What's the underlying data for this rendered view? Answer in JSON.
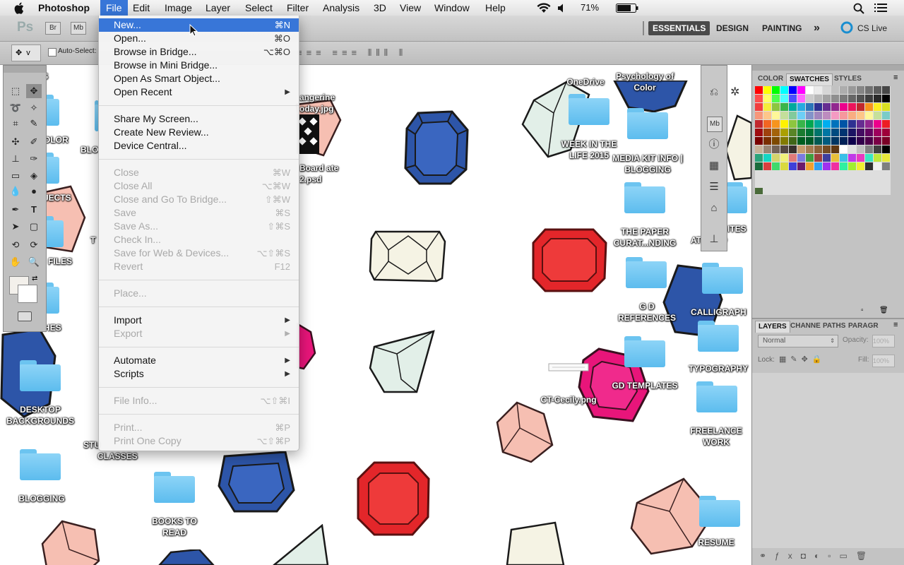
{
  "menubar": {
    "apple_icon": "apple-icon",
    "app_name": "Photoshop",
    "items": [
      "File",
      "Edit",
      "Image",
      "Layer",
      "Select",
      "Filter",
      "Analysis",
      "3D",
      "View",
      "Window",
      "Help"
    ],
    "battery": "71%"
  },
  "appbar": {
    "ps_logo": "Ps",
    "br_button": "Br",
    "mb_button": "Mb",
    "workspaces": [
      "ESSENTIALS",
      "DESIGN",
      "PAINTING"
    ],
    "more": "»",
    "cs_live": "CS Live"
  },
  "options": {
    "auto_select": "Auto-Select:",
    "tool_preset": "v"
  },
  "file_menu": {
    "groups": [
      [
        {
          "label": "New...",
          "shortcut": "⌘N"
        },
        {
          "label": "Open...",
          "shortcut": "⌘O"
        },
        {
          "label": "Browse in Bridge...",
          "shortcut": "⌥⌘O"
        },
        {
          "label": "Browse in Mini Bridge...",
          "shortcut": ""
        },
        {
          "label": "Open As Smart Object...",
          "shortcut": ""
        },
        {
          "label": "Open Recent",
          "shortcut": "",
          "submenu": true
        }
      ],
      [
        {
          "label": "Share My Screen...",
          "shortcut": ""
        },
        {
          "label": "Create New Review...",
          "shortcut": ""
        },
        {
          "label": "Device Central...",
          "shortcut": ""
        }
      ],
      [
        {
          "label": "Close",
          "shortcut": "⌘W",
          "disabled": true
        },
        {
          "label": "Close All",
          "shortcut": "⌥⌘W",
          "disabled": true
        },
        {
          "label": "Close and Go To Bridge...",
          "shortcut": "⇧⌘W",
          "disabled": true
        },
        {
          "label": "Save",
          "shortcut": "⌘S",
          "disabled": true
        },
        {
          "label": "Save As...",
          "shortcut": "⇧⌘S",
          "disabled": true
        },
        {
          "label": "Check In...",
          "shortcut": "",
          "disabled": true
        },
        {
          "label": "Save for Web & Devices...",
          "shortcut": "⌥⇧⌘S",
          "disabled": true
        },
        {
          "label": "Revert",
          "shortcut": "F12",
          "disabled": true
        }
      ],
      [
        {
          "label": "Place...",
          "shortcut": "",
          "disabled": true
        }
      ],
      [
        {
          "label": "Import",
          "shortcut": "",
          "submenu": true
        },
        {
          "label": "Export",
          "shortcut": "",
          "submenu": true,
          "disabled": true
        }
      ],
      [
        {
          "label": "Automate",
          "shortcut": "",
          "submenu": true
        },
        {
          "label": "Scripts",
          "shortcut": "",
          "submenu": true
        }
      ],
      [
        {
          "label": "File Info...",
          "shortcut": "⌥⇧⌘I",
          "disabled": true
        }
      ],
      [
        {
          "label": "Print...",
          "shortcut": "⌘P",
          "disabled": true
        },
        {
          "label": "Print One Copy",
          "shortcut": "⌥⇧⌘P",
          "disabled": true
        }
      ]
    ]
  },
  "panels": {
    "color_tabs": [
      "COLOR",
      "SWATCHES",
      "STYLES"
    ],
    "layer_tabs": [
      "LAYERS",
      "CHANNE",
      "PATHS",
      "PARAGR"
    ],
    "blend_mode": "Normal",
    "opacity_label": "Opacity:",
    "opacity_value": "100%",
    "lock_label": "Lock:",
    "fill_label": "Fill:",
    "fill_value": "100%",
    "swatch_colors": [
      "#ff0000",
      "#ffff00",
      "#00ff00",
      "#00ffff",
      "#0000ff",
      "#ff00ff",
      "#ffffff",
      "#e6e6e6",
      "#cccccc",
      "#b3b3b3",
      "#999999",
      "#808080",
      "#666666",
      "#4d4d4d",
      "#333333",
      "#1a1a1a",
      "#000000"
    ]
  },
  "desktop": {
    "labels": [
      {
        "text": "ALS"
      },
      {
        "text": "OLOR"
      },
      {
        "text": "BLO"
      },
      {
        "text": "JECTS"
      },
      {
        "text": "T"
      },
      {
        "text": "FILES"
      },
      {
        "text": "HES"
      },
      {
        "text": "DESKTOP BACKGROUNDS"
      },
      {
        "text": "BLOGGING"
      },
      {
        "text": "STU"
      },
      {
        "text": "CLASSES"
      },
      {
        "text": "BOOKS TO READ"
      },
      {
        "text": "angerine oday.jpg"
      },
      {
        "text": "Board ate 2.psd"
      },
      {
        "text": "OneDrive"
      },
      {
        "text": "Psychology of Color"
      },
      {
        "text": "WEEK IN THE LIFE 2015"
      },
      {
        "text": "MEDIA KIT INFO | BLOGGING"
      },
      {
        "text": "THE PAPER CURAT...NDING"
      },
      {
        "text": "G D REFERENCES"
      },
      {
        "text": "GD TEMPLATES"
      },
      {
        "text": "CT-Cecily.png"
      },
      {
        "text": "SITES"
      },
      {
        "text": "AT RATO"
      },
      {
        "text": "CALLIGRAPH"
      },
      {
        "text": "TYPOGRAPHY"
      },
      {
        "text": "FREELANCE WORK"
      },
      {
        "text": "RESUME"
      }
    ]
  }
}
